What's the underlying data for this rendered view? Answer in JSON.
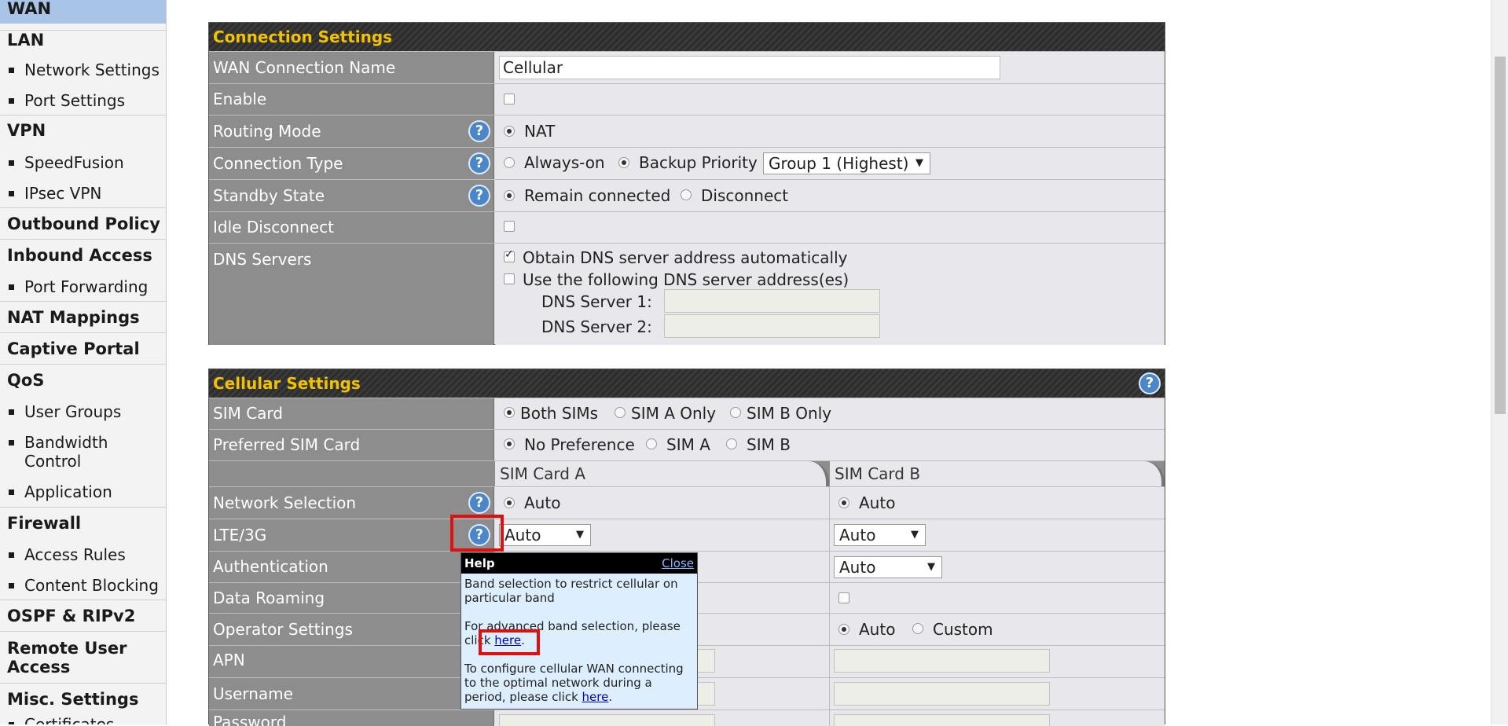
{
  "sidebar": {
    "wan": "WAN",
    "lan": "LAN",
    "network_settings": "Network Settings",
    "port_settings": "Port Settings",
    "vpn": "VPN",
    "speedfusion": "SpeedFusion",
    "ipsec_vpn": "IPsec VPN",
    "outbound_policy": "Outbound Policy",
    "inbound_access": "Inbound Access",
    "port_forwarding": "Port Forwarding",
    "nat_mappings": "NAT Mappings",
    "captive_portal": "Captive Portal",
    "qos": "QoS",
    "user_groups": "User Groups",
    "bandwidth_control_1": "Bandwidth",
    "bandwidth_control_2": "Control",
    "application": "Application",
    "firewall": "Firewall",
    "access_rules": "Access Rules",
    "content_blocking": "Content Blocking",
    "ospf_ripv2": "OSPF & RIPv2",
    "remote_user_access_1": "Remote User",
    "remote_user_access_2": "Access",
    "misc_settings": "Misc. Settings",
    "certificates": "Certificates"
  },
  "connection": {
    "title": "Connection Settings",
    "wan_name_label": "WAN Connection Name",
    "wan_name_value": "Cellular",
    "enable_label": "Enable",
    "routing_mode_label": "Routing Mode",
    "routing_nat": "NAT",
    "connection_type_label": "Connection Type",
    "always_on": "Always-on",
    "backup_priority": "Backup Priority",
    "backup_group": "Group 1 (Highest)",
    "standby_label": "Standby State",
    "remain_connected": "Remain connected",
    "disconnect": "Disconnect",
    "idle_label": "Idle Disconnect",
    "dns_label": "DNS Servers",
    "dns_auto": "Obtain DNS server address automatically",
    "dns_manual": "Use the following DNS server address(es)",
    "dns1": "DNS Server 1:",
    "dns2": "DNS Server 2:"
  },
  "cellular": {
    "title": "Cellular Settings",
    "sim_card_label": "SIM Card",
    "both_sims": "Both SIMs",
    "sim_a_only": "SIM A Only",
    "sim_b_only": "SIM B Only",
    "preferred_label": "Preferred SIM Card",
    "no_preference": "No Preference",
    "sim_a": "SIM A",
    "sim_b": "SIM B",
    "tab_a": "SIM Card A",
    "tab_b": "SIM Card B",
    "network_selection_label": "Network Selection",
    "auto": "Auto",
    "lte_label": "LTE/3G",
    "lte_a": "Auto",
    "lte_b": "Auto",
    "auth_label": "Authentication",
    "auth_b": "Auto",
    "roaming_label": "Data Roaming",
    "operator_label": "Operator Settings",
    "custom": "Custom",
    "apn_label": "APN",
    "username_label": "Username",
    "password_label": "Password"
  },
  "help_popup": {
    "title": "Help",
    "close": "Close",
    "line1": "Band selection to restrict cellular on",
    "line2": "particular band",
    "line3": "For advanced band selection, please",
    "line4_pre": "click ",
    "here1": "here",
    "period1": ".",
    "line5": "To configure cellular WAN connecting",
    "line6": "to the optimal network during a",
    "line7_pre": "period, please click ",
    "here2": "here",
    "period2": "."
  },
  "icons": {
    "help": "question-mark-circle-icon",
    "help_glyph": "?"
  },
  "colors": {
    "section_title": "#f2c200",
    "label_bg": "#8d8d8d",
    "help_icon": "#4a86c8",
    "highlight_box": "#e01010",
    "sidebar_active": "#a8c4e6"
  }
}
